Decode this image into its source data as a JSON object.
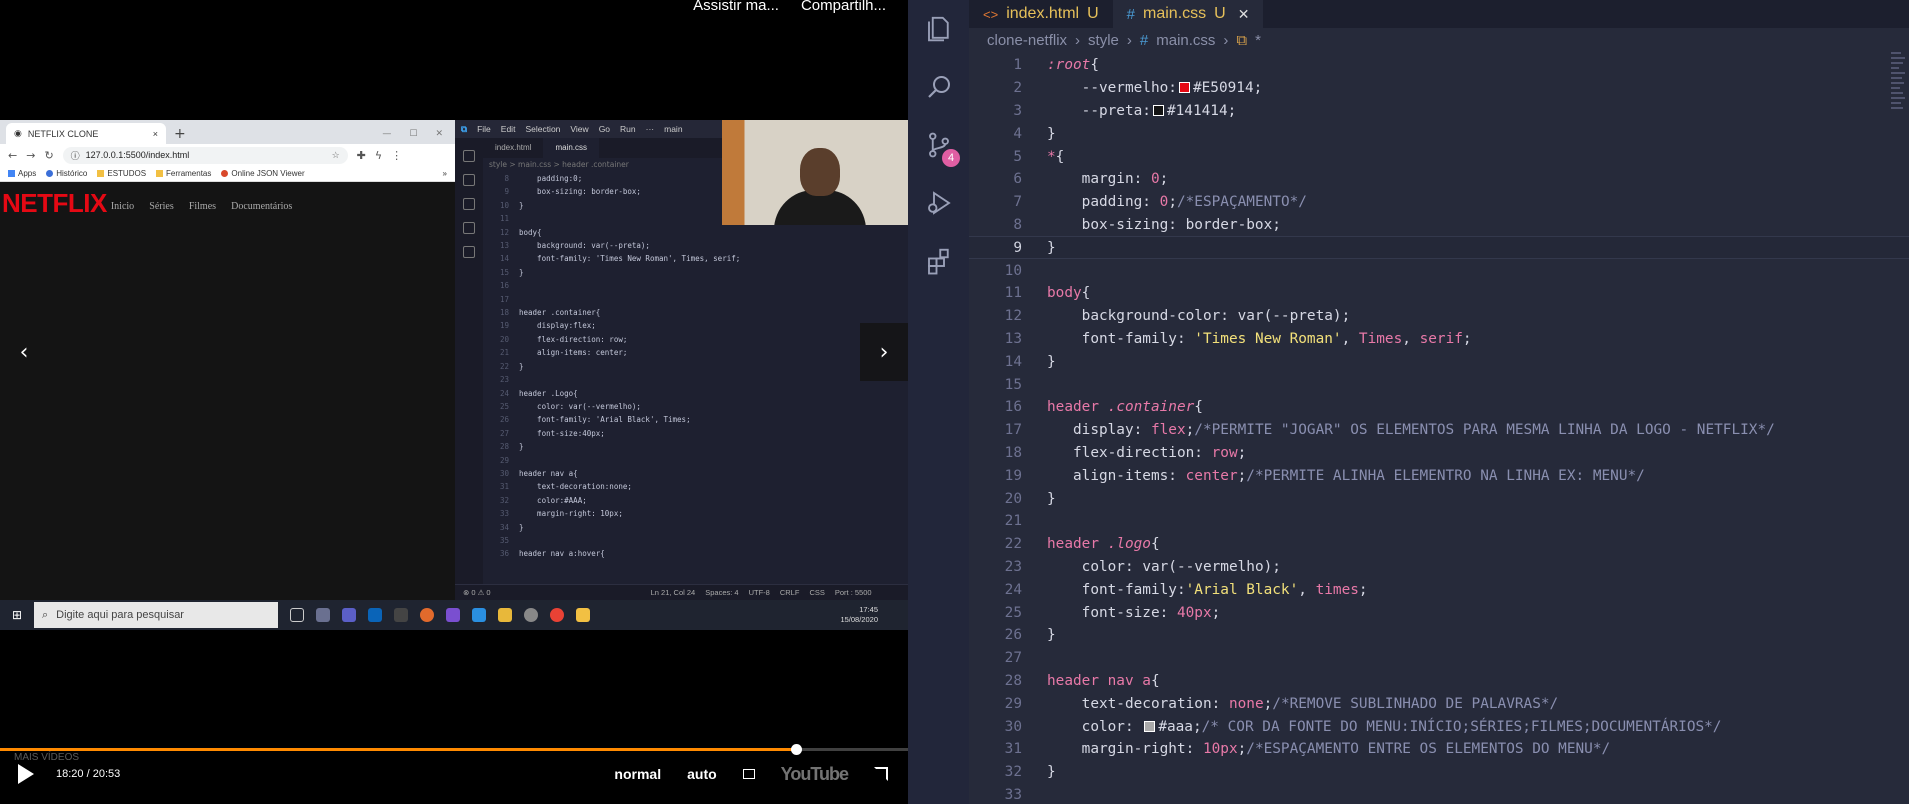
{
  "video": {
    "top_actions": [
      "Assistir ma...",
      "Compartilh..."
    ],
    "browser": {
      "tab_title": "NETFLIX CLONE",
      "tab_close": "×",
      "new_tab": "+",
      "url": "127.0.0.1:5500/index.html",
      "bookmarks": [
        "Apps",
        "Histórico",
        "ESTUDOS",
        "Ferramentas",
        "Online JSON Viewer"
      ],
      "bookmarks_more": "»"
    },
    "netflix": {
      "logo": "NETFLIX",
      "nav": [
        "Inicio",
        "Séries",
        "Filmes",
        "Documentários"
      ]
    },
    "mini_vscode": {
      "menu": [
        "File",
        "Edit",
        "Selection",
        "View",
        "Go",
        "Run",
        "···",
        "main"
      ],
      "tabs": [
        "index.html",
        "main.css"
      ],
      "breadcrumb": "style > main.css > header .container",
      "lines": [
        {
          "n": "8",
          "t": "    padding:0;"
        },
        {
          "n": "9",
          "t": "    box-sizing: border-box;"
        },
        {
          "n": "10",
          "t": "}"
        },
        {
          "n": "11",
          "t": ""
        },
        {
          "n": "12",
          "t": "body{"
        },
        {
          "n": "13",
          "t": "    background: var(--preta);"
        },
        {
          "n": "14",
          "t": "    font-family: 'Times New Roman', Times, serif;"
        },
        {
          "n": "15",
          "t": "}"
        },
        {
          "n": "16",
          "t": ""
        },
        {
          "n": "17",
          "t": ""
        },
        {
          "n": "18",
          "t": "header .container{"
        },
        {
          "n": "19",
          "t": "    display:flex;"
        },
        {
          "n": "20",
          "t": "    flex-direction: row;"
        },
        {
          "n": "21",
          "t": "    align-items: center;"
        },
        {
          "n": "22",
          "t": "}"
        },
        {
          "n": "23",
          "t": ""
        },
        {
          "n": "24",
          "t": "header .Logo{"
        },
        {
          "n": "25",
          "t": "    color: var(--vermelho);"
        },
        {
          "n": "26",
          "t": "    font-family: 'Arial Black', Times;"
        },
        {
          "n": "27",
          "t": "    font-size:40px;"
        },
        {
          "n": "28",
          "t": "}"
        },
        {
          "n": "29",
          "t": ""
        },
        {
          "n": "30",
          "t": "header nav a{"
        },
        {
          "n": "31",
          "t": "    text-decoration:none;"
        },
        {
          "n": "32",
          "t": "    color:#AAA;"
        },
        {
          "n": "33",
          "t": "    margin-right: 10px;"
        },
        {
          "n": "34",
          "t": "}"
        },
        {
          "n": "35",
          "t": ""
        },
        {
          "n": "36",
          "t": "header nav a:hover{"
        }
      ],
      "status_left": "⊗ 0 ⚠ 0",
      "status_right": [
        "Ln 21, Col 24",
        "Spaces: 4",
        "UTF-8",
        "CRLF",
        "CSS",
        "Port : 5500"
      ]
    },
    "taskbar": {
      "search_placeholder": "Digite aqui para pesquisar",
      "time": "17:45",
      "date": "15/08/2020"
    },
    "player": {
      "overlay_text": "MAIS VÍDEOS",
      "current_time": "18:20",
      "separator": "/",
      "duration": "20:53",
      "progress_fraction": 0.877,
      "speed": "normal",
      "quality": "auto",
      "brand": "YouTube",
      "progress_color": "#ff8a00"
    }
  },
  "editor": {
    "tabs": [
      {
        "name": "index.html",
        "status": "U",
        "active": false
      },
      {
        "name": "main.css",
        "status": "U",
        "active": true
      }
    ],
    "breadcrumb": [
      "clone-netflix",
      "style",
      "main.css",
      "*"
    ],
    "scm_badge": "4",
    "current_line": 9,
    "lines": [
      {
        "n": "1",
        "tokens": [
          {
            "c": "t-sel-i",
            "t": ":root"
          },
          {
            "c": "t-pun",
            "t": "{"
          }
        ]
      },
      {
        "n": "2",
        "tokens": [
          {
            "c": "t-prop",
            "t": "    --vermelho:"
          },
          {
            "c": "swatch",
            "color": "#E50914"
          },
          {
            "c": "t-hex",
            "t": "#E50914;"
          }
        ]
      },
      {
        "n": "3",
        "tokens": [
          {
            "c": "t-prop",
            "t": "    --preta:"
          },
          {
            "c": "swatch",
            "color": "#141414"
          },
          {
            "c": "t-hex",
            "t": "#141414;"
          }
        ]
      },
      {
        "n": "4",
        "tokens": [
          {
            "c": "t-pun",
            "t": "}"
          }
        ]
      },
      {
        "n": "5",
        "tokens": [
          {
            "c": "t-sel",
            "t": "*"
          },
          {
            "c": "t-pun",
            "t": "{"
          }
        ]
      },
      {
        "n": "6",
        "tokens": [
          {
            "c": "t-prop",
            "t": "    margin: "
          },
          {
            "c": "t-val",
            "t": "0"
          },
          {
            "c": "t-pun",
            "t": ";"
          }
        ]
      },
      {
        "n": "7",
        "tokens": [
          {
            "c": "t-prop",
            "t": "    padding: "
          },
          {
            "c": "t-val",
            "t": "0"
          },
          {
            "c": "t-pun",
            "t": ";"
          },
          {
            "c": "t-com",
            "t": "/*ESPAÇAMENTO*/"
          }
        ]
      },
      {
        "n": "8",
        "tokens": [
          {
            "c": "t-prop",
            "t": "    box-sizing: "
          },
          {
            "c": "t-prop",
            "t": "border-box"
          },
          {
            "c": "t-pun",
            "t": ";"
          }
        ]
      },
      {
        "n": "9",
        "tokens": [
          {
            "c": "t-pun",
            "t": "}"
          }
        ]
      },
      {
        "n": "10",
        "tokens": []
      },
      {
        "n": "11",
        "tokens": [
          {
            "c": "t-sel",
            "t": "body"
          },
          {
            "c": "t-pun",
            "t": "{"
          }
        ]
      },
      {
        "n": "12",
        "tokens": [
          {
            "c": "t-prop",
            "t": "    background-color: "
          },
          {
            "c": "t-prop",
            "t": "var(--preta)"
          },
          {
            "c": "t-pun",
            "t": ";"
          }
        ]
      },
      {
        "n": "13",
        "tokens": [
          {
            "c": "t-prop",
            "t": "    font-family: "
          },
          {
            "c": "t-str",
            "t": "'Times New Roman'"
          },
          {
            "c": "t-pun",
            "t": ", "
          },
          {
            "c": "t-val",
            "t": "Times"
          },
          {
            "c": "t-pun",
            "t": ", "
          },
          {
            "c": "t-val",
            "t": "serif"
          },
          {
            "c": "t-pun",
            "t": ";"
          }
        ]
      },
      {
        "n": "14",
        "tokens": [
          {
            "c": "t-pun",
            "t": "}"
          }
        ]
      },
      {
        "n": "15",
        "tokens": []
      },
      {
        "n": "16",
        "tokens": [
          {
            "c": "t-sel",
            "t": "header "
          },
          {
            "c": "t-sel-i",
            "t": ".container"
          },
          {
            "c": "t-pun",
            "t": "{"
          }
        ]
      },
      {
        "n": "17",
        "tokens": [
          {
            "c": "t-prop",
            "t": "   display: "
          },
          {
            "c": "t-val",
            "t": "flex"
          },
          {
            "c": "t-pun",
            "t": ";"
          },
          {
            "c": "t-com",
            "t": "/*PERMITE \"JOGAR\" OS ELEMENTOS PARA MESMA LINHA DA LOGO - NETFLIX*/"
          }
        ]
      },
      {
        "n": "18",
        "tokens": [
          {
            "c": "t-prop",
            "t": "   flex-direction: "
          },
          {
            "c": "t-val",
            "t": "row"
          },
          {
            "c": "t-pun",
            "t": ";"
          }
        ]
      },
      {
        "n": "19",
        "tokens": [
          {
            "c": "t-prop",
            "t": "   align-items: "
          },
          {
            "c": "t-val",
            "t": "center"
          },
          {
            "c": "t-pun",
            "t": ";"
          },
          {
            "c": "t-com",
            "t": "/*PERMITE ALINHA ELEMENTRO NA LINHA EX: MENU*/"
          }
        ]
      },
      {
        "n": "20",
        "tokens": [
          {
            "c": "t-pun",
            "t": "}"
          }
        ]
      },
      {
        "n": "21",
        "tokens": []
      },
      {
        "n": "22",
        "tokens": [
          {
            "c": "t-sel",
            "t": "header "
          },
          {
            "c": "t-sel-i",
            "t": ".logo"
          },
          {
            "c": "t-pun",
            "t": "{"
          }
        ]
      },
      {
        "n": "23",
        "tokens": [
          {
            "c": "t-prop",
            "t": "    color: "
          },
          {
            "c": "t-prop",
            "t": "var(--vermelho)"
          },
          {
            "c": "t-pun",
            "t": ";"
          }
        ]
      },
      {
        "n": "24",
        "tokens": [
          {
            "c": "t-prop",
            "t": "    font-family:"
          },
          {
            "c": "t-str",
            "t": "'Arial Black'"
          },
          {
            "c": "t-pun",
            "t": ", "
          },
          {
            "c": "t-val",
            "t": "times"
          },
          {
            "c": "t-pun",
            "t": ";"
          }
        ]
      },
      {
        "n": "25",
        "tokens": [
          {
            "c": "t-prop",
            "t": "    font-size: "
          },
          {
            "c": "t-val",
            "t": "40px"
          },
          {
            "c": "t-pun",
            "t": ";"
          }
        ]
      },
      {
        "n": "26",
        "tokens": [
          {
            "c": "t-pun",
            "t": "}"
          }
        ]
      },
      {
        "n": "27",
        "tokens": []
      },
      {
        "n": "28",
        "tokens": [
          {
            "c": "t-sel",
            "t": "header nav a"
          },
          {
            "c": "t-pun",
            "t": "{"
          }
        ]
      },
      {
        "n": "29",
        "tokens": [
          {
            "c": "t-prop",
            "t": "    text-decoration: "
          },
          {
            "c": "t-val",
            "t": "none"
          },
          {
            "c": "t-pun",
            "t": ";"
          },
          {
            "c": "t-com",
            "t": "/*REMOVE SUBLINHADO DE PALAVRAS*/"
          }
        ]
      },
      {
        "n": "30",
        "tokens": [
          {
            "c": "t-prop",
            "t": "    color: "
          },
          {
            "c": "swatch",
            "color": "#aaaaaa"
          },
          {
            "c": "t-hex",
            "t": "#aaa"
          },
          {
            "c": "t-pun",
            "t": ";"
          },
          {
            "c": "t-com",
            "t": "/* COR DA FONTE DO MENU:INÍCIO;SÉRIES;FILMES;DOCUMENTÁRIOS*/"
          }
        ]
      },
      {
        "n": "31",
        "tokens": [
          {
            "c": "t-prop",
            "t": "    margin-right: "
          },
          {
            "c": "t-val",
            "t": "10px"
          },
          {
            "c": "t-pun",
            "t": ";"
          },
          {
            "c": "t-com",
            "t": "/*ESPAÇAMENTO ENTRE OS ELEMENTOS DO MENU*/"
          }
        ]
      },
      {
        "n": "32",
        "tokens": [
          {
            "c": "t-pun",
            "t": "}"
          }
        ]
      },
      {
        "n": "33",
        "tokens": []
      }
    ]
  }
}
